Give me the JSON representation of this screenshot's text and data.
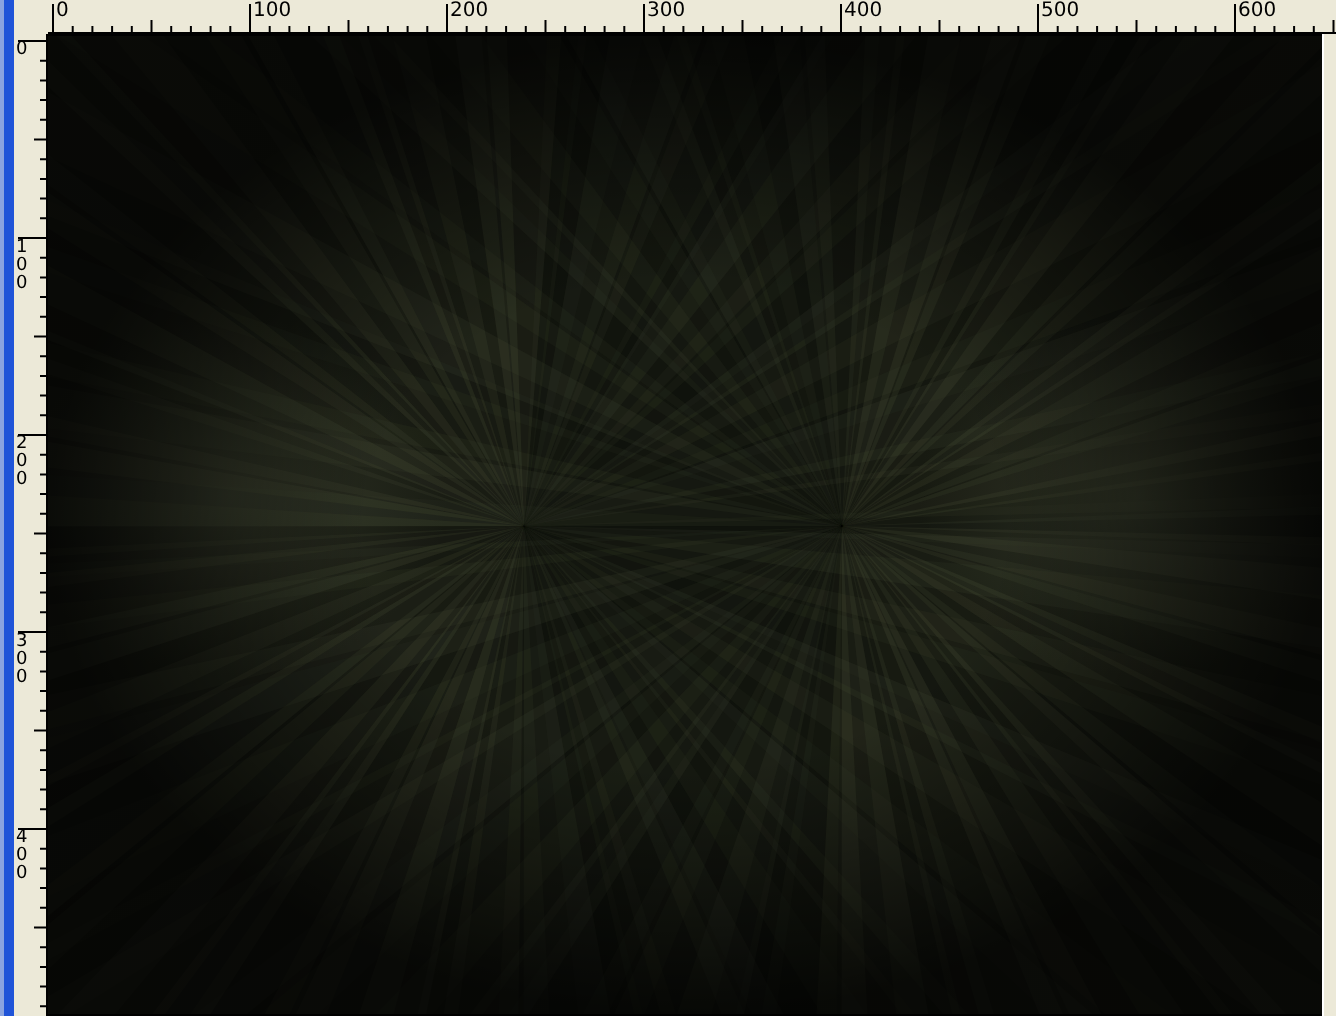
{
  "horizontal_ruler": {
    "labels": [
      "0",
      "100",
      "200",
      "300",
      "400",
      "500",
      "600"
    ]
  },
  "vertical_ruler": {
    "labels": [
      "0",
      "100",
      "200",
      "300",
      "400"
    ]
  }
}
